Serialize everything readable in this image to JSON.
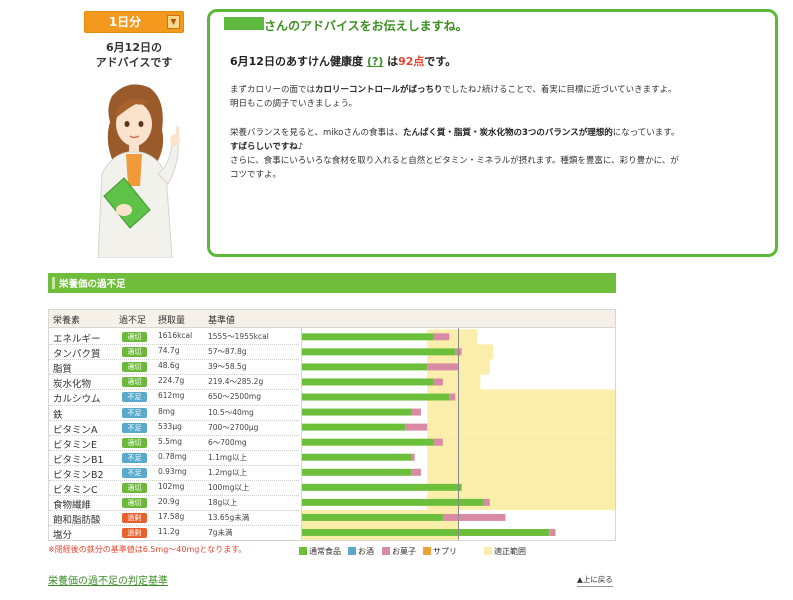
{
  "left": {
    "day_select": "1日分",
    "date_line1": "6月12日の",
    "date_line2": "アドバイスです"
  },
  "advice": {
    "heading": "さんのアドバイスをお伝えしますね。",
    "score_prefix": "6月12日のあすけん健康度",
    "score_help": "(?)",
    "score_mid": "は",
    "score_value": "92点",
    "score_suffix": "です。",
    "p1_a": "まずカロリーの面では",
    "p1_b": "カロリーコントロールがばっちり",
    "p1_c": "でしたね♪続けることで、着実に目標に近づいていきますよ。",
    "p1_d": "明日もこの調子でいきましょう。",
    "p2_a": "栄養バランスを見ると、mikoさんの食事は、",
    "p2_b": "たんぱく質・脂質・炭水化物の3つのバランスが理想的",
    "p2_c": "になっています。",
    "p2_d": "すばらしいですね♪",
    "p2_e": "さらに、食事にいろいろな食材を取り入れると自然とビタミン・ミネラルが摂れます。種類を豊富に、彩り豊かに、が",
    "p2_f": "コツですよ。"
  },
  "section_title": "栄養価の過不足",
  "table": {
    "headers": [
      "栄養素",
      "過不足",
      "摂取量",
      "基準値"
    ],
    "rows": [
      {
        "name": "エネルギー",
        "status": "適切",
        "amount": "1616kcal",
        "ref": "1555〜1955kcal",
        "food": 0.42,
        "sweets": 0.05,
        "ideal_lo": 0.4,
        "ideal_hi": 0.56
      },
      {
        "name": "タンパク質",
        "status": "適切",
        "amount": "74.7g",
        "ref": "57〜87.8g",
        "food": 0.49,
        "sweets": 0.02,
        "ideal_lo": 0.4,
        "ideal_hi": 0.61
      },
      {
        "name": "脂質",
        "status": "適切",
        "amount": "48.6g",
        "ref": "39〜58.5g",
        "food": 0.4,
        "sweets": 0.1,
        "ideal_lo": 0.4,
        "ideal_hi": 0.6
      },
      {
        "name": "炭水化物",
        "status": "適切",
        "amount": "224.7g",
        "ref": "219.4〜285.2g",
        "food": 0.42,
        "sweets": 0.03,
        "ideal_lo": 0.4,
        "ideal_hi": 0.57
      },
      {
        "name": "カルシウム",
        "status": "不足",
        "amount": "612mg",
        "ref": "650〜2500mg",
        "food": 0.47,
        "sweets": 0.02,
        "ideal_lo": 0.4,
        "ideal_hi": 1.0
      },
      {
        "name": "鉄",
        "status": "不足",
        "amount": "8mg",
        "ref": "10.5〜40mg",
        "food": 0.35,
        "sweets": 0.03,
        "ideal_lo": 0.4,
        "ideal_hi": 1.0
      },
      {
        "name": "ビタミンA",
        "status": "不足",
        "amount": "533μg",
        "ref": "700〜2700μg",
        "food": 0.33,
        "sweets": 0.07,
        "ideal_lo": 0.4,
        "ideal_hi": 1.0
      },
      {
        "name": "ビタミンE",
        "status": "適切",
        "amount": "5.5mg",
        "ref": "6〜700mg",
        "food": 0.42,
        "sweets": 0.03,
        "ideal_lo": 0.4,
        "ideal_hi": 1.0
      },
      {
        "name": "ビタミンB1",
        "status": "不足",
        "amount": "0.78mg",
        "ref": "1.1mg以上",
        "food": 0.35,
        "sweets": 0.01,
        "ideal_lo": 0.4,
        "ideal_hi": 1.0
      },
      {
        "name": "ビタミンB2",
        "status": "不足",
        "amount": "0.93mg",
        "ref": "1.2mg以上",
        "food": 0.35,
        "sweets": 0.03,
        "ideal_lo": 0.4,
        "ideal_hi": 1.0
      },
      {
        "name": "ビタミンC",
        "status": "適切",
        "amount": "102mg",
        "ref": "100mg以上",
        "food": 0.51,
        "sweets": 0.0,
        "ideal_lo": 0.4,
        "ideal_hi": 1.0
      },
      {
        "name": "食物繊維",
        "status": "適切",
        "amount": "20.9g",
        "ref": "18g以上",
        "food": 0.58,
        "sweets": 0.02,
        "ideal_lo": 0.4,
        "ideal_hi": 1.0
      },
      {
        "name": "飽和脂肪酸",
        "status": "過剰",
        "amount": "17.58g",
        "ref": "13.65g未満",
        "food": 0.45,
        "sweets": 0.2,
        "ideal_lo": 0.0,
        "ideal_hi": 0.5
      },
      {
        "name": "塩分",
        "status": "過剰",
        "amount": "11.2g",
        "ref": "7g未満",
        "food": 0.79,
        "sweets": 0.02,
        "ideal_lo": 0.0,
        "ideal_hi": 0.5
      }
    ]
  },
  "status_colors": {
    "適切": "#6cb83a",
    "不足": "#58a9cc",
    "過剰": "#e8602c"
  },
  "footnote": "※閉経後の鉄分の基準値は6.5mg〜40mgとなります。",
  "legend": [
    {
      "label": "通常食品",
      "color": "#6cbf3a"
    },
    {
      "label": "お酒",
      "color": "#58a9cc"
    },
    {
      "label": "お菓子",
      "color": "#d98aa4"
    },
    {
      "label": "サプリ",
      "color": "#f0a03a"
    },
    {
      "label": "適正範囲",
      "color": "#fbeeaa"
    }
  ],
  "criteria_link": "栄養価の過不足の判定基準",
  "top_link": "上に戻る"
}
